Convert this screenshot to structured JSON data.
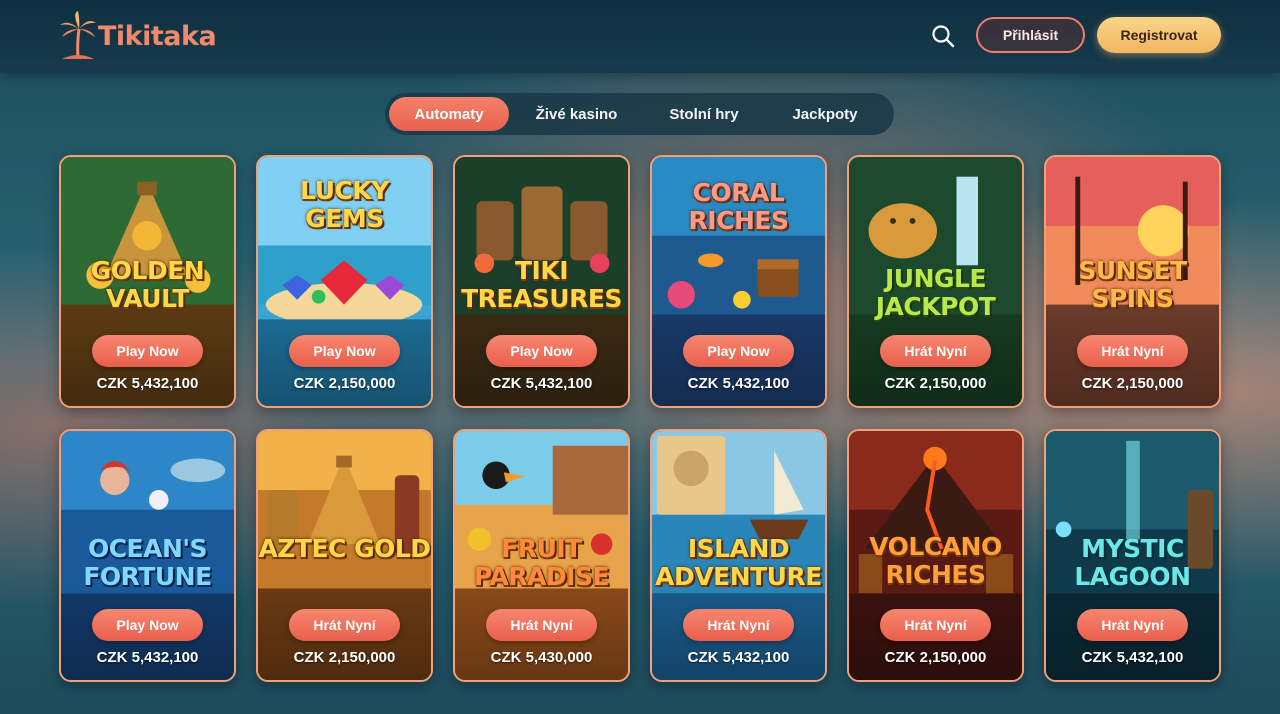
{
  "brand": {
    "name": "Tikitaka"
  },
  "header": {
    "login_label": "Přihlásit",
    "register_label": "Registrovat"
  },
  "tabs": [
    {
      "label": "Automaty",
      "active": true
    },
    {
      "label": "Živé kasino",
      "active": false
    },
    {
      "label": "Stolní hry",
      "active": false
    },
    {
      "label": "Jackpoty",
      "active": false
    }
  ],
  "games": [
    {
      "title": "GOLDEN VAULT",
      "button": "Play Now",
      "jackpot": "CZK 5,432,100"
    },
    {
      "title": "LUCKY GEMS",
      "button": "Play Now",
      "jackpot": "CZK 2,150,000"
    },
    {
      "title": "TIKI TREASURES",
      "button": "Play Now",
      "jackpot": "CZK 5,432,100"
    },
    {
      "title": "CORAL RICHES",
      "button": "Play Now",
      "jackpot": "CZK 5,432,100"
    },
    {
      "title": "JUNGLE JACKPOT",
      "button": "Hrát Nyní",
      "jackpot": "CZK 2,150,000"
    },
    {
      "title": "SUNSET SPINS",
      "button": "Hrát Nyní",
      "jackpot": "CZK 2,150,000"
    },
    {
      "title": "OCEAN'S FORTUNE",
      "button": "Play Now",
      "jackpot": "CZK 5,432,100"
    },
    {
      "title": "AZTEC GOLD",
      "button": "Hrát Nyní",
      "jackpot": "CZK 2,150,000"
    },
    {
      "title": "FRUIT PARADISE",
      "button": "Hrát Nyní",
      "jackpot": "CZK 5,430,000"
    },
    {
      "title": "ISLAND ADVENTURE",
      "button": "Hrát Nyní",
      "jackpot": "CZK 5,432,100"
    },
    {
      "title": "VOLCANO RICHES",
      "button": "Hrát Nyní",
      "jackpot": "CZK 2,150,000"
    },
    {
      "title": "MYSTIC LAGOON",
      "button": "Hrát Nyní",
      "jackpot": "CZK 5,432,100"
    }
  ],
  "colors": {
    "accent": "#ef6f5a",
    "register_gold": "#f5c070",
    "header_bg": "#123547",
    "title_gold": "#ffd84a"
  },
  "icons": [
    "palm-tree-logo-icon",
    "search-icon"
  ]
}
